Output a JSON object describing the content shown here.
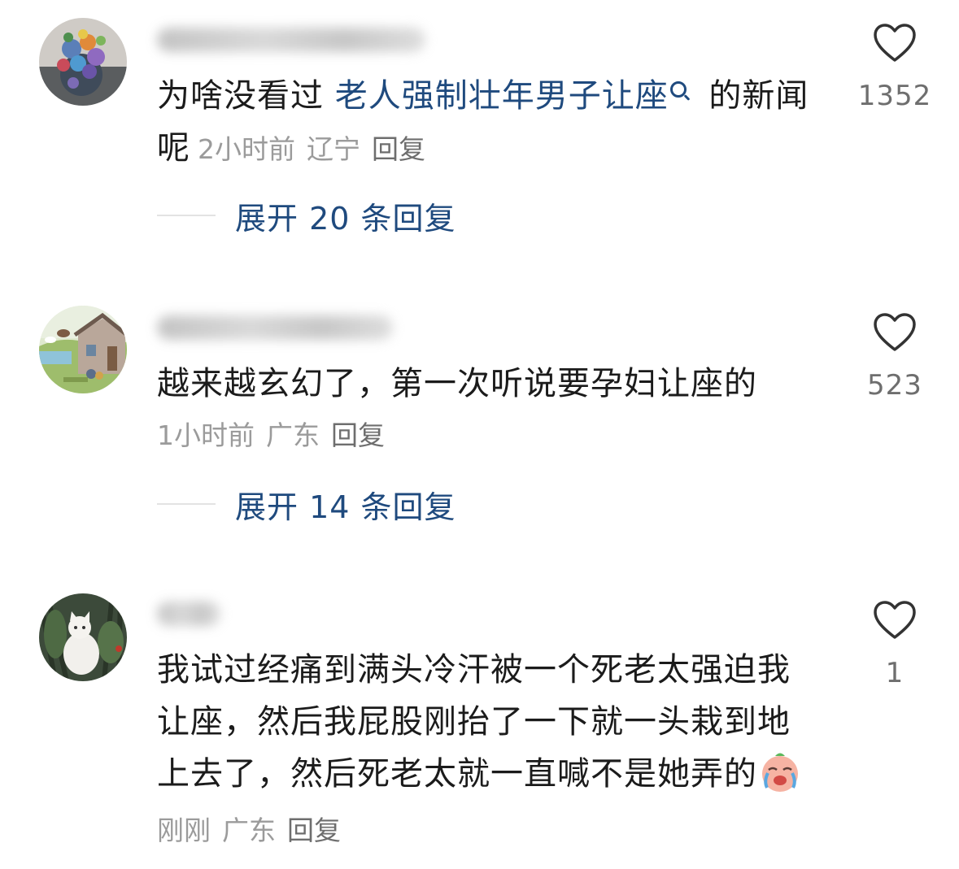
{
  "comments": [
    {
      "avatar": "avatar-flowers",
      "text_before": "为啥没看过 ",
      "keyword": "老人强制壮年男子让座",
      "keyword_icon": "search-icon",
      "text_after": " 的新闻",
      "text_last_line": "呢",
      "time": "2小时前",
      "location": "辽宁",
      "reply_label": "回复",
      "expand_label": "展开 20 条回复",
      "likes": "1352"
    },
    {
      "avatar": "avatar-cottage",
      "text": "越来越玄幻了，第一次听说要孕妇让座的",
      "time": "1小时前",
      "location": "广东",
      "reply_label": "回复",
      "expand_label": "展开 14 条回复",
      "likes": "523"
    },
    {
      "avatar": "avatar-cat",
      "text": "我试过经痛到满头冷汗被一个死老太强迫我让座，然后我屁股刚抬了一下就一头栽到地上去了，然后死老太就一直喊不是她弄的",
      "emoji": "crying-face-emoji",
      "time": "刚刚",
      "location": "广东",
      "reply_label": "回复",
      "likes": "1"
    }
  ],
  "colors": {
    "link": "#1f4a7e",
    "text": "#1b1b1b",
    "meta": "#9b9b9b",
    "count": "#6e6e6e"
  }
}
